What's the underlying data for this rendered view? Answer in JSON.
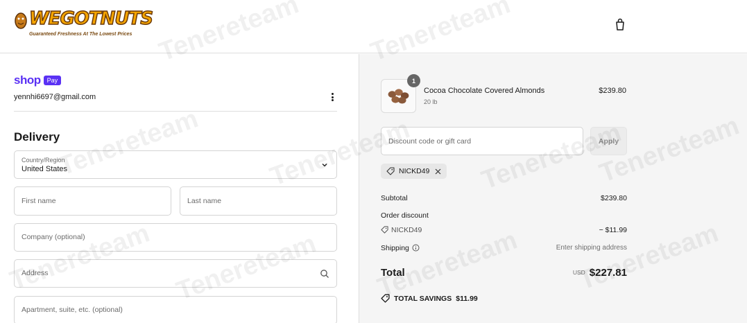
{
  "header": {
    "logo_text": "WEGOTNUTS",
    "logo_tagline": "Guaranteed Freshness At The Lowest Prices",
    "cart_icon": "shopping-bag-icon"
  },
  "account": {
    "shop_label": "shop",
    "pay_label": "Pay",
    "email": "yennhi6697@gmail.com"
  },
  "delivery": {
    "title": "Delivery",
    "country_label": "Country/Region",
    "country_value": "United States",
    "first_name_placeholder": "First name",
    "last_name_placeholder": "Last name",
    "company_placeholder": "Company (optional)",
    "address_placeholder": "Address",
    "apartment_placeholder": "Apartment, suite, etc. (optional)"
  },
  "summary": {
    "item": {
      "name": "Cocoa Chocolate Covered Almonds",
      "variant": "20 lb",
      "quantity": "1",
      "price": "$239.80"
    },
    "discount_placeholder": "Discount code or gift card",
    "apply_label": "Apply",
    "applied_code": "NICKD49",
    "subtotal_label": "Subtotal",
    "subtotal_value": "$239.80",
    "order_discount_label": "Order discount",
    "discount_code": "NICKD49",
    "discount_value": "− $11.99",
    "shipping_label": "Shipping",
    "shipping_value": "Enter shipping address",
    "total_label": "Total",
    "total_currency": "USD",
    "total_value": "$227.81",
    "savings_label": "TOTAL SAVINGS",
    "savings_value": "$11.99"
  },
  "watermark": "Tenereteam",
  "colors": {
    "shop_pay": "#5a31f4",
    "summary_bg": "#f5f5f5",
    "logo_yellow": "#f5a500"
  }
}
